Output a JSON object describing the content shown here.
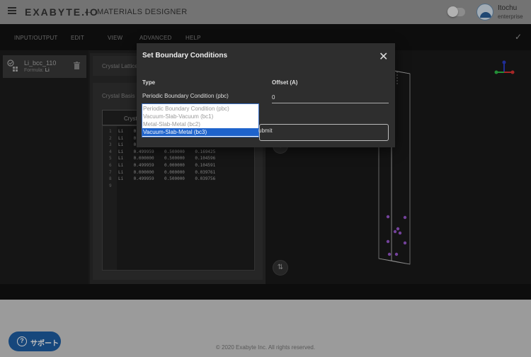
{
  "header": {
    "brand": "EXABYTE.IO",
    "app_title": "MATERIALS DESIGNER",
    "user_name": "Itochu",
    "user_sub": "enterprise"
  },
  "menu": {
    "items": [
      "INPUT/OUTPUT",
      "EDIT",
      "VIEW",
      "ADVANCED",
      "HELP"
    ]
  },
  "sidebar": {
    "material_name": "Li_bcc_110",
    "formula_label": "Formula:",
    "formula_value": "Li"
  },
  "center": {
    "lattice_label": "Crystal Lattice",
    "basis_label": "Crystal Basis",
    "editor_tab": "Cryst",
    "code_lines": [
      {
        "n": "1",
        "t": "Li    0.000000    0.000000    0.169432"
      },
      {
        "n": "2",
        "t": "Li    0.499959    0.500000    0.169432"
      },
      {
        "n": "3",
        "t": "Li    0.000000    0.000000    0.169432"
      },
      {
        "n": "4",
        "t": "Li    0.499959    0.500000    0.169425"
      },
      {
        "n": "5",
        "t": "Li    0.000000    0.500000    0.104596"
      },
      {
        "n": "6",
        "t": "Li    0.499959    0.000000    0.104591"
      },
      {
        "n": "7",
        "t": "Li    0.000000    0.000000    0.039761"
      },
      {
        "n": "8",
        "t": "Li    0.499959    0.500000    0.039756"
      },
      {
        "n": "9",
        "t": ""
      }
    ]
  },
  "modal": {
    "title": "Set Boundary Conditions",
    "type_label": "Type",
    "offset_label": "Offset (A)",
    "type_value": "Periodic Boundary Condition (pbc)",
    "offset_value": "0",
    "submit_label": "Submit",
    "options": [
      "Periodic Boundary Condition (pbc)",
      "Vacuum-Slab-Vacuum (bc1)",
      "Metal-Slab-Metal (bc2)",
      "Vacuum-Slab-Metal (bc3)"
    ]
  },
  "footer": {
    "copyright": "© 2020 Exabyte Inc. All rights reserved.",
    "support_label": "サポート"
  },
  "colors": {
    "accent": "#1e63cc",
    "atom": "#9b59d0",
    "support": "#1e5fa6"
  }
}
